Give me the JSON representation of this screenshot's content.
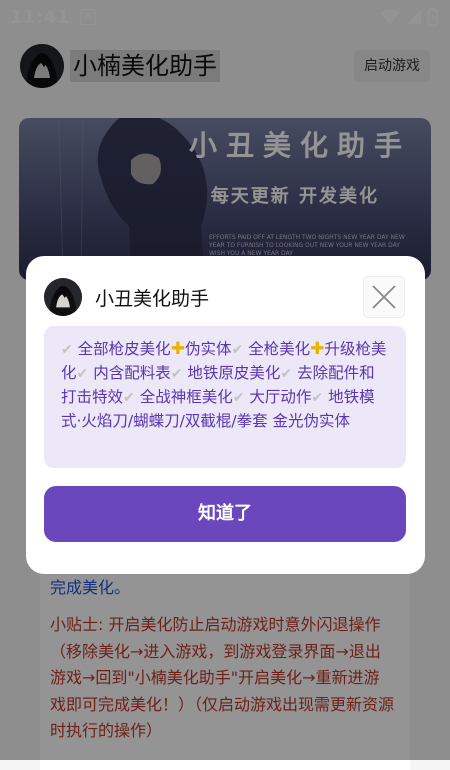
{
  "status_bar": {
    "time": "11:41",
    "notification_badge": "A"
  },
  "header": {
    "app_title": "小楠美化助手",
    "launch_button": "启动游戏"
  },
  "banner": {
    "title": "小丑美化助手",
    "subtitle": "每天更新 开发美化",
    "small_text": "EFFORTS PAID OFF AT LENGTH TWO NIGHTS NEW YEAR DAY NEW YEAR TO FURNISH TO LOOKING OUT NEW YOUR NEW YEAR DAY WISH YOU A NEW YEAR DAY"
  },
  "content": {
    "tail": "完成美化。",
    "tip": "小贴士: 开启美化防止启动游戏时意外闪退操作（移除美化→进入游戏，到游戏登录界面→退出游戏→回到\"小楠美化助手\"开启美化→重新进游戏即可完成美化！）（仅启动游戏出现需更新资源时执行的操作）"
  },
  "dialog": {
    "title": "小丑美化助手",
    "features": {
      "f1": "全部枪皮美化",
      "f2": "伪实体",
      "f3": "全枪美化",
      "f4": "升级枪美化",
      "f5": "内含配料表",
      "f6": "地铁原皮美化",
      "f7": "去除配件和打击特效",
      "f8": "全战神框美化",
      "f9": "大厅动作",
      "f10": "地铁模式·火焰刀/蝴蝶刀/双截棍/拳套 金光伪实体"
    },
    "confirm_button": "知道了"
  },
  "colors": {
    "accent_purple": "#6a47bd",
    "notice_bg": "#ece8f7",
    "notice_text": "#5b36b0",
    "tip_red": "#c0392b",
    "link_blue": "#1a56db"
  },
  "icons": {
    "check": "check-icon",
    "plus": "plus-icon",
    "close": "close-icon",
    "wifi": "wifi-icon",
    "signal": "signal-icon",
    "battery": "battery-icon"
  }
}
